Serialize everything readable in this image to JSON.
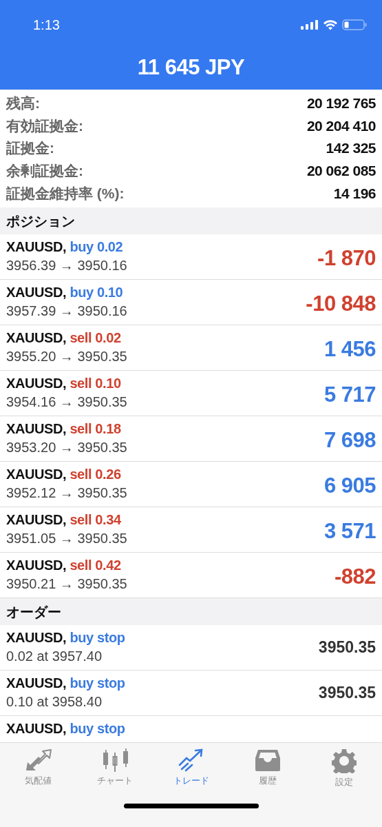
{
  "status_bar": {
    "time": "1:13"
  },
  "header": {
    "title": "11 645 JPY"
  },
  "account": [
    {
      "label": "残高:",
      "value": "20 192 765"
    },
    {
      "label": "有効証拠金:",
      "value": "20 204 410"
    },
    {
      "label": "証拠金:",
      "value": "142 325"
    },
    {
      "label": "余剰証拠金:",
      "value": "20 062 085"
    },
    {
      "label": "証拠金維持率 (%):",
      "value": "14 196"
    }
  ],
  "positions": {
    "title": "ポジション",
    "items": [
      {
        "symbol": "XAUUSD,",
        "kind": "buy",
        "order": "buy 0.02",
        "prices": "3956.39 → 3950.16",
        "profit": "-1 870",
        "color": "#d0412f"
      },
      {
        "symbol": "XAUUSD,",
        "kind": "buy",
        "order": "buy 0.10",
        "prices": "3957.39 → 3950.16",
        "profit": "-10 848",
        "color": "#d0412f"
      },
      {
        "symbol": "XAUUSD,",
        "kind": "sell",
        "order": "sell 0.02",
        "prices": "3955.20 → 3950.35",
        "profit": "1 456",
        "color": "#3a7be0"
      },
      {
        "symbol": "XAUUSD,",
        "kind": "sell",
        "order": "sell 0.10",
        "prices": "3954.16 → 3950.35",
        "profit": "5 717",
        "color": "#3a7be0"
      },
      {
        "symbol": "XAUUSD,",
        "kind": "sell",
        "order": "sell 0.18",
        "prices": "3953.20 → 3950.35",
        "profit": "7 698",
        "color": "#3a7be0"
      },
      {
        "symbol": "XAUUSD,",
        "kind": "sell",
        "order": "sell 0.26",
        "prices": "3952.12 → 3950.35",
        "profit": "6 905",
        "color": "#3a7be0"
      },
      {
        "symbol": "XAUUSD,",
        "kind": "sell",
        "order": "sell 0.34",
        "prices": "3951.05 → 3950.35",
        "profit": "3 571",
        "color": "#3a7be0"
      },
      {
        "symbol": "XAUUSD,",
        "kind": "sell",
        "order": "sell 0.42",
        "prices": "3950.21 → 3950.35",
        "profit": "-882",
        "color": "#d0412f"
      }
    ]
  },
  "orders": {
    "title": "オーダー",
    "items": [
      {
        "symbol": "XAUUSD,",
        "kind": "buy",
        "order": "buy stop",
        "details": "0.02 at 3957.40",
        "price": "3950.35"
      },
      {
        "symbol": "XAUUSD,",
        "kind": "buy",
        "order": "buy stop",
        "details": "0.10 at 3958.40",
        "price": "3950.35"
      },
      {
        "symbol": "XAUUSD,",
        "kind": "buy",
        "order": "buy stop"
      }
    ]
  },
  "tab_bar": [
    {
      "label": "気配値",
      "selected": false
    },
    {
      "label": "チャート",
      "selected": false
    },
    {
      "label": "トレード",
      "selected": true
    },
    {
      "label": "履歴",
      "selected": false
    },
    {
      "label": "設定",
      "selected": false
    }
  ]
}
